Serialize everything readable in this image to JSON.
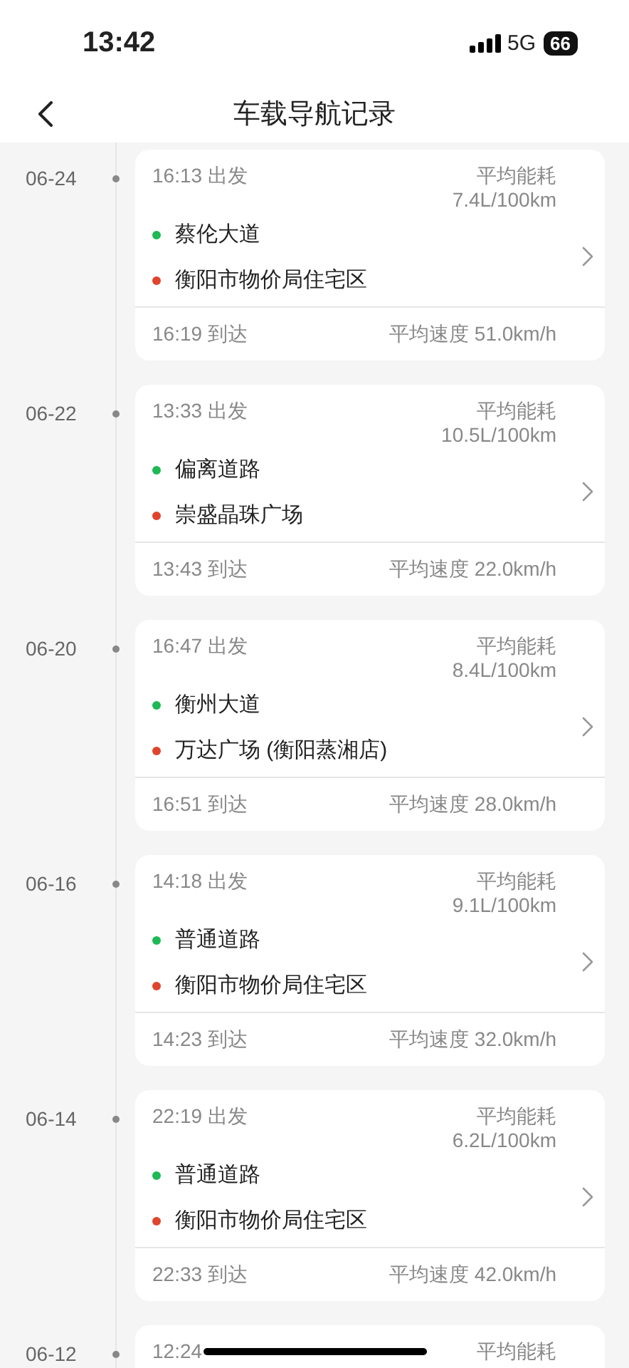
{
  "status_bar": {
    "time": "13:42",
    "network": "5G",
    "battery": "66"
  },
  "header": {
    "title": "车载导航记录"
  },
  "trips": [
    {
      "date": "06-24",
      "depart": "16:13 出发",
      "energy_label": "平均能耗",
      "energy": "7.4L/100km",
      "origin": "蔡伦大道",
      "destination": "衡阳市物价局住宅区",
      "arrive": "16:19 到达",
      "speed": "平均速度 51.0km/h"
    },
    {
      "date": "06-22",
      "depart": "13:33 出发",
      "energy_label": "平均能耗",
      "energy": "10.5L/100km",
      "origin": "偏离道路",
      "destination": "崇盛晶珠广场",
      "arrive": "13:43 到达",
      "speed": "平均速度 22.0km/h"
    },
    {
      "date": "06-20",
      "depart": "16:47 出发",
      "energy_label": "平均能耗",
      "energy": "8.4L/100km",
      "origin": "衡州大道",
      "destination": "万达广场 (衡阳蒸湘店)",
      "arrive": "16:51 到达",
      "speed": "平均速度 28.0km/h"
    },
    {
      "date": "06-16",
      "depart": "14:18 出发",
      "energy_label": "平均能耗",
      "energy": "9.1L/100km",
      "origin": "普通道路",
      "destination": "衡阳市物价局住宅区",
      "arrive": "14:23 到达",
      "speed": "平均速度 32.0km/h"
    },
    {
      "date": "06-14",
      "depart": "22:19 出发",
      "energy_label": "平均能耗",
      "energy": "6.2L/100km",
      "origin": "普通道路",
      "destination": "衡阳市物价局住宅区",
      "arrive": "22:33 到达",
      "speed": "平均速度 42.0km/h"
    },
    {
      "date": "06-12",
      "depart": "12:24",
      "energy_label": "平均能耗"
    }
  ]
}
